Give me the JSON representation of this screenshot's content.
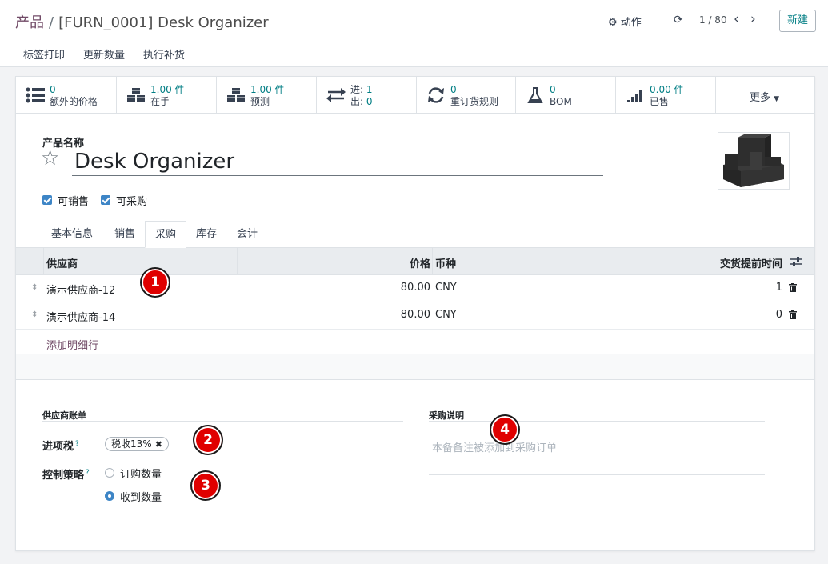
{
  "breadcrumb": {
    "root": "产品",
    "separator": "/",
    "current": "[FURN_0001] Desk Organizer"
  },
  "header": {
    "action_label": "动作",
    "pager": "1 / 80",
    "new_label": "新建"
  },
  "toolbar": {
    "print_labels": "标签打印",
    "update_qty": "更新数量",
    "replenish": "执行补货"
  },
  "smart_buttons": [
    {
      "icon": "list-icon",
      "value": "0",
      "label": "额外的价格"
    },
    {
      "icon": "cubes-icon",
      "value": "1.00 件",
      "label": "在手"
    },
    {
      "icon": "cubes-icon",
      "value": "1.00 件",
      "label": "预测"
    },
    {
      "icon": "exchange-icon",
      "in_label": "进:",
      "in_value": "1",
      "out_label": "出:",
      "out_value": "0"
    },
    {
      "icon": "refresh-icon",
      "value": "0",
      "label": "重订货规则"
    },
    {
      "icon": "flask-icon",
      "value": "0",
      "label": "BOM"
    },
    {
      "icon": "signal-icon",
      "value": "0.00 件",
      "label": "已售"
    },
    {
      "label": "更多"
    }
  ],
  "product": {
    "name_label": "产品名称",
    "name": "Desk Organizer",
    "can_be_sold": "可销售",
    "can_be_purchased": "可采购"
  },
  "tabs": [
    "基本信息",
    "销售",
    "采购",
    "库存",
    "会计"
  ],
  "active_tab": "采购",
  "vendor_table": {
    "headers": {
      "vendor": "供应商",
      "price": "价格",
      "currency": "币种",
      "lead_time": "交货提前时间"
    },
    "rows": [
      {
        "vendor": "演示供应商-12",
        "price": "80.00",
        "currency": "CNY",
        "lead_time": "1"
      },
      {
        "vendor": "演示供应商-14",
        "price": "80.00",
        "currency": "CNY",
        "lead_time": "0"
      }
    ],
    "add_line": "添加明细行"
  },
  "vendor_bills": {
    "title": "供应商账单",
    "tax_label": "进项税",
    "tax_tag": "税收13%",
    "policy_label": "控制策略",
    "policy_options": [
      "订购数量",
      "收到数量"
    ],
    "policy_selected": "收到数量",
    "help_mark": "?"
  },
  "purchase_notes": {
    "title": "采购说明",
    "placeholder": "本备备注被添加到采购订单"
  },
  "annotations": [
    "1",
    "2",
    "3",
    "4"
  ],
  "colors": {
    "primary": "#714b67",
    "accent": "#017e84",
    "checkbox": "#3d85c6",
    "badge": "#e00000"
  }
}
